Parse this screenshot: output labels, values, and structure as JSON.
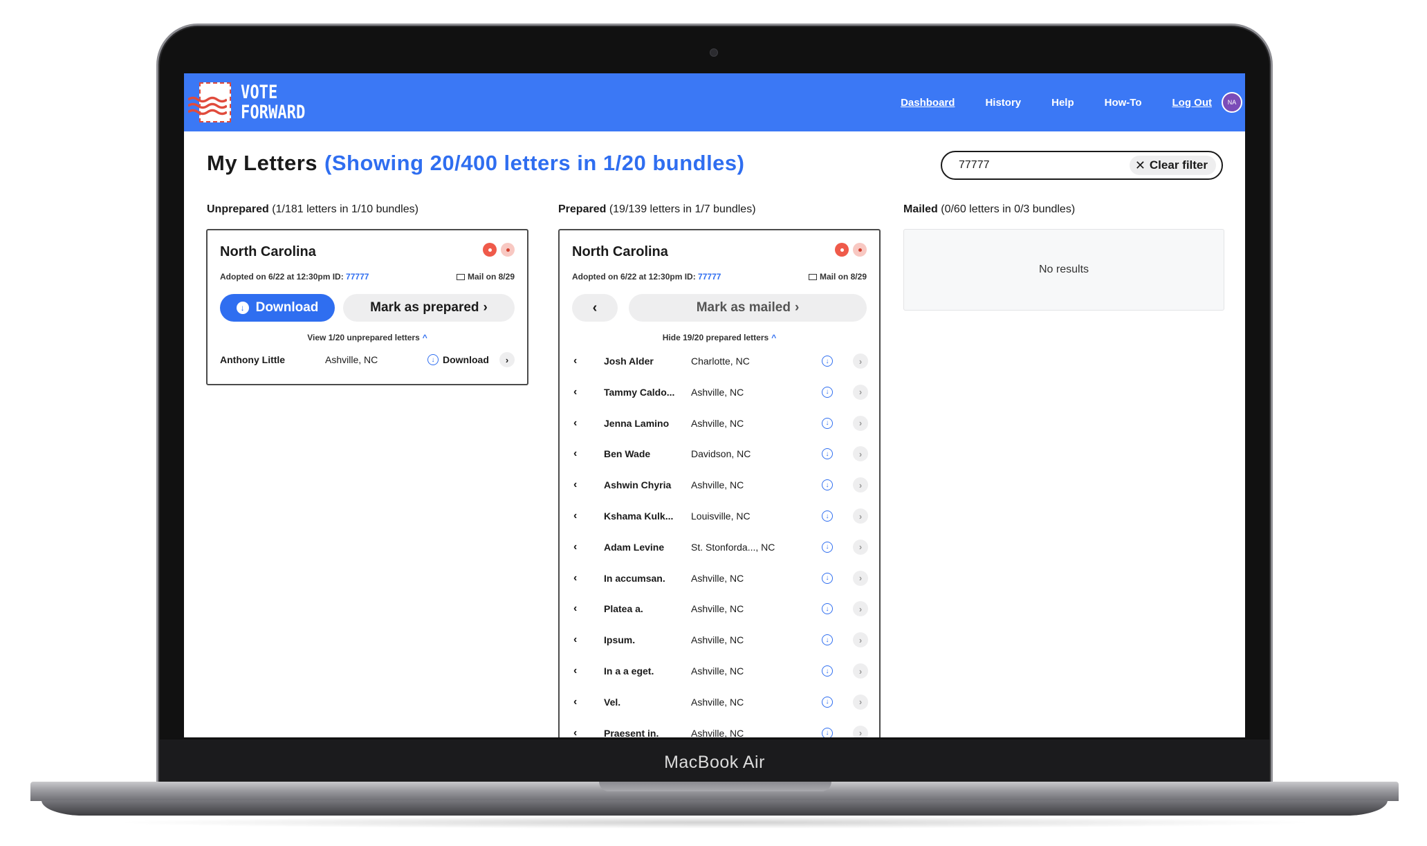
{
  "device_label": "MacBook Air",
  "logo": {
    "line1": "VOTE",
    "line2": "FORWARD"
  },
  "nav": {
    "dashboard": "Dashboard",
    "history": "History",
    "help": "Help",
    "howto": "How-To",
    "logout": "Log Out",
    "avatar": "NA"
  },
  "title": "My Letters",
  "subtitle": "(Showing 20/400 letters in 1/20 bundles)",
  "filter": {
    "value": "77777",
    "clear_label": "Clear filter"
  },
  "colors": {
    "brand": "#3b78f5",
    "accent": "#2f6ef0",
    "danger": "#ef5a4a"
  },
  "unprepared": {
    "label": "Unprepared",
    "count": "(1/181 letters in 1/10 bundles)",
    "card": {
      "state": "North Carolina",
      "adopted": "Adopted on 6/22 at 12:30pm ID:",
      "id": "77777",
      "mail_on": "Mail on 8/29",
      "download_label": "Download",
      "mark_label": "Mark as prepared",
      "toggle_label": "View 1/20 unprepared letters",
      "row": {
        "name": "Anthony Little",
        "city": "Ashville, NC",
        "download": "Download"
      }
    }
  },
  "prepared": {
    "label": "Prepared",
    "count": "(19/139 letters in 1/7 bundles)",
    "card": {
      "state": "North Carolina",
      "adopted": "Adopted on 6/22 at 12:30pm ID:",
      "id": "77777",
      "mail_on": "Mail on 8/29",
      "mark_label": "Mark as mailed",
      "toggle_label": "Hide 19/20 prepared letters",
      "rows": [
        {
          "name": "Josh Alder",
          "city": "Charlotte, NC"
        },
        {
          "name": "Tammy Caldo...",
          "city": "Ashville, NC"
        },
        {
          "name": "Jenna Lamino",
          "city": "Ashville, NC"
        },
        {
          "name": "Ben Wade",
          "city": "Davidson, NC"
        },
        {
          "name": "Ashwin Chyria",
          "city": "Ashville, NC"
        },
        {
          "name": "Kshama Kulk...",
          "city": "Louisville, NC"
        },
        {
          "name": "Adam Levine",
          "city": "St. Stonforda..., NC"
        },
        {
          "name": "In accumsan.",
          "city": "Ashville, NC"
        },
        {
          "name": "Platea a.",
          "city": "Ashville, NC"
        },
        {
          "name": "Ipsum.",
          "city": "Ashville, NC"
        },
        {
          "name": "In a a eget.",
          "city": "Ashville, NC"
        },
        {
          "name": "Vel.",
          "city": "Ashville, NC"
        },
        {
          "name": "Praesent in.",
          "city": "Ashville, NC"
        }
      ]
    }
  },
  "mailed": {
    "label": "Mailed",
    "count": "(0/60 letters in 0/3 bundles)",
    "empty": "No results"
  }
}
